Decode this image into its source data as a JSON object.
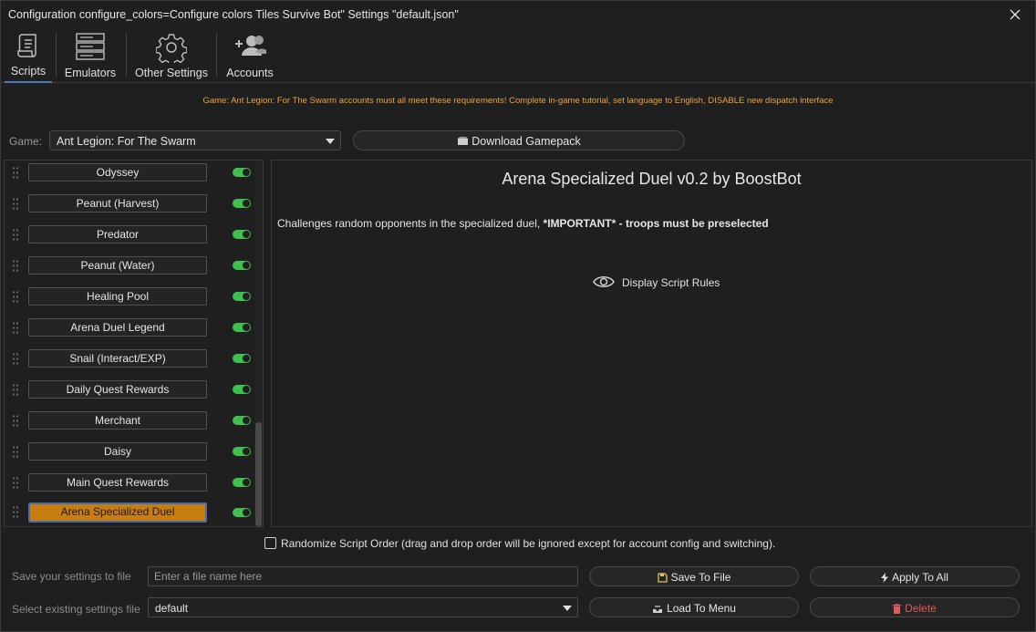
{
  "window": {
    "title": "Configuration configure_colors=Configure colors Tiles Survive Bot\" Settings \"default.json\""
  },
  "toolbar": {
    "tabs": [
      {
        "label": "Scripts",
        "icon": "scroll-icon",
        "active": true
      },
      {
        "label": "Emulators",
        "icon": "server-icon",
        "active": false
      },
      {
        "label": "Other Settings",
        "icon": "gear-icon",
        "active": false
      },
      {
        "label": "Accounts",
        "icon": "users-plus-icon",
        "active": false
      }
    ]
  },
  "notice": {
    "text": "Game: Ant Legion: For The Swarm accounts must all meet these requirements! Complete in-game tutorial, set language to English, DISABLE new dispatch interface",
    "color": "#e8a33c"
  },
  "game": {
    "label": "Game:",
    "selected": "Ant Legion: For The Swarm",
    "download_label": "Download Gamepack"
  },
  "scripts": [
    {
      "label": "Odyssey",
      "enabled": true
    },
    {
      "label": "Peanut (Harvest)",
      "enabled": true
    },
    {
      "label": "Predator",
      "enabled": true
    },
    {
      "label": "Peanut (Water)",
      "enabled": true
    },
    {
      "label": "Healing Pool",
      "enabled": true
    },
    {
      "label": "Arena Duel Legend",
      "enabled": true
    },
    {
      "label": "Snail (Interact/EXP)",
      "enabled": true
    },
    {
      "label": "Daily Quest Rewards",
      "enabled": true
    },
    {
      "label": "Merchant",
      "enabled": true
    },
    {
      "label": "Daisy",
      "enabled": true
    },
    {
      "label": "Main Quest Rewards",
      "enabled": true
    },
    {
      "label": "Arena Specialized Duel",
      "enabled": true,
      "selected": true
    }
  ],
  "detail": {
    "title": "Arena Specialized Duel v0.2 by BoostBot",
    "description_plain": "Challenges random opponents in the specialized duel, ",
    "description_bold": "*IMPORTANT* - troops must be preselected",
    "rules_label": "Display Script Rules"
  },
  "randomize": {
    "label": "Randomize Script Order (drag and drop order will be ignored except for account config and switching).",
    "checked": false
  },
  "save": {
    "label": "Save your settings to file",
    "placeholder": "Enter a file name here",
    "save_button": "Save To File",
    "apply_button": "Apply To All"
  },
  "load": {
    "label": "Select existing settings file",
    "selected": "default",
    "load_button": "Load To Menu",
    "delete_button": "Delete"
  },
  "colors": {
    "accent_selected": "#c87d0e",
    "toggle_on": "#3fbf4d",
    "delete": "#e05a5a"
  }
}
